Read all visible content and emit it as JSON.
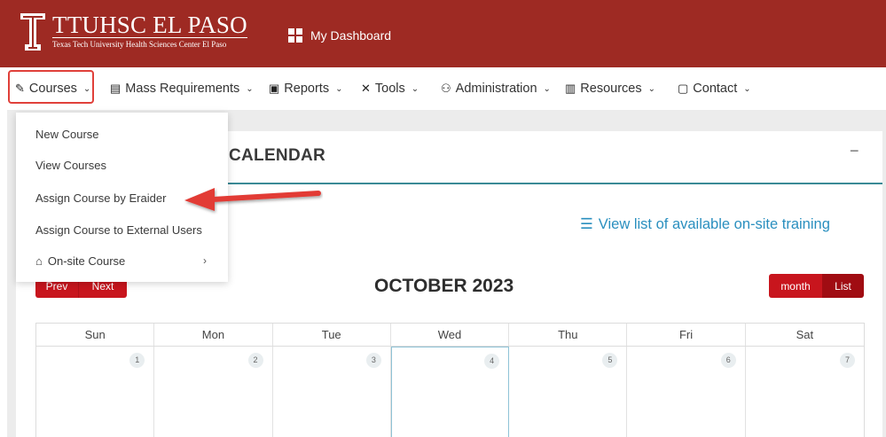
{
  "header": {
    "logo_title": "TTUHSC EL PASO",
    "logo_subtitle": "Texas Tech University Health Sciences Center El Paso",
    "dashboard_label": "My Dashboard"
  },
  "nav": {
    "items": [
      {
        "label": "Courses",
        "icon": "pencil-icon"
      },
      {
        "label": "Mass Requirements",
        "icon": "clipboard-icon"
      },
      {
        "label": "Reports",
        "icon": "monitor-icon"
      },
      {
        "label": "Tools",
        "icon": "tools-icon"
      },
      {
        "label": "Administration",
        "icon": "users-icon"
      },
      {
        "label": "Resources",
        "icon": "book-icon"
      },
      {
        "label": "Contact",
        "icon": "contact-card-icon"
      }
    ]
  },
  "dropdown": {
    "items": [
      {
        "label": "New Course"
      },
      {
        "label": "View Courses"
      },
      {
        "label": "Assign Course by Eraider"
      },
      {
        "label": "Assign Course to External Users"
      },
      {
        "label": "On-site Course",
        "icon": "building-icon",
        "has_submenu": true
      }
    ]
  },
  "card": {
    "title": "CALENDAR",
    "minimize": "−",
    "view_list_link": "View list of available on-site training"
  },
  "calendar": {
    "prev_label": "Prev",
    "next_label": "Next",
    "month_title": "OCTOBER 2023",
    "month_label": "month",
    "list_label": "List",
    "weekdays": [
      "Sun",
      "Mon",
      "Tue",
      "Wed",
      "Thu",
      "Fri",
      "Sat"
    ],
    "first_week": [
      "1",
      "2",
      "3",
      "4",
      "5",
      "6",
      "7"
    ]
  },
  "colors": {
    "header_bg": "#9e2a23",
    "button_red": "#c8151d",
    "link_blue": "#2a8fbf",
    "accent_teal": "#3a8a96",
    "highlight_box": "#e0403a"
  }
}
